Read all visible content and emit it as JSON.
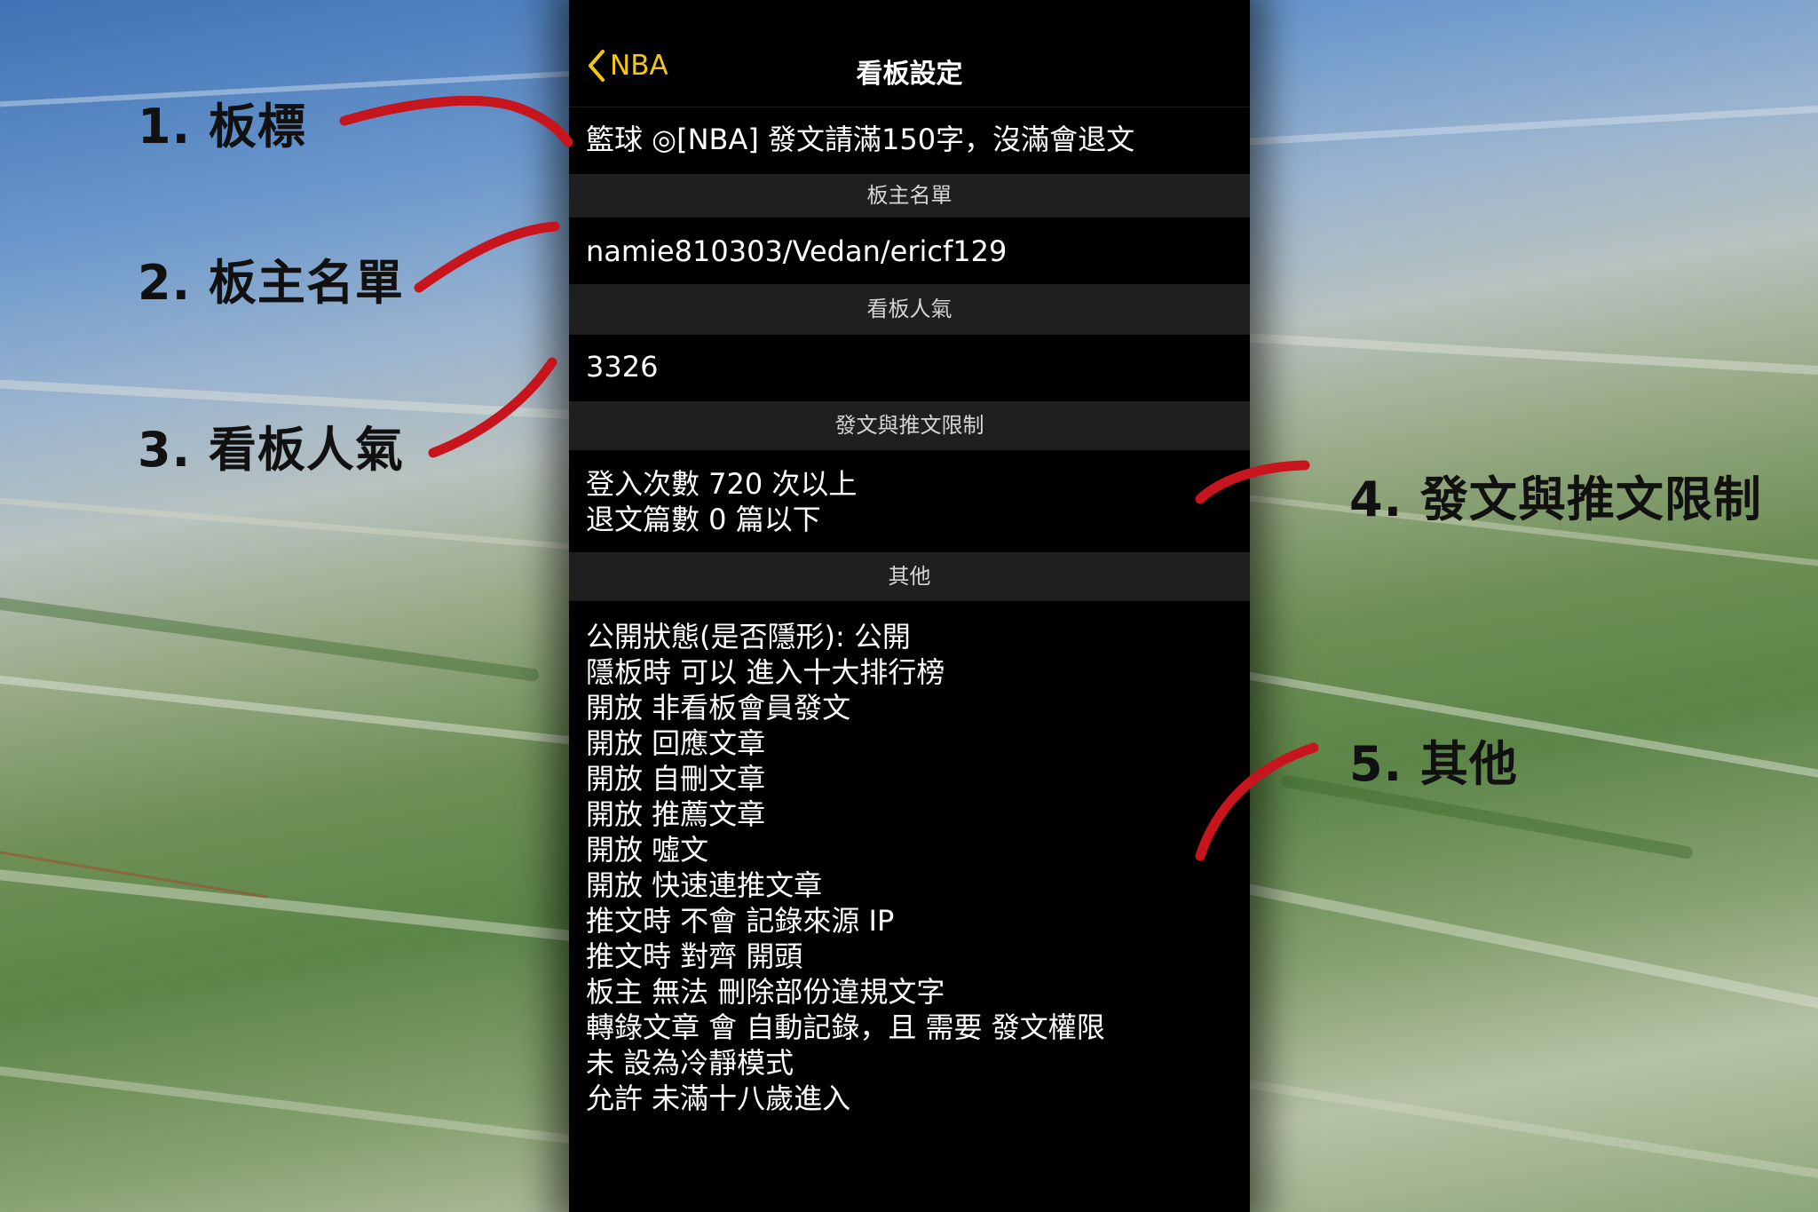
{
  "nav": {
    "back_label": "NBA",
    "title": "看板設定"
  },
  "board_title": "籃球 ◎[NBA] 發文請滿150字，沒滿會退文",
  "sections": {
    "moderators": {
      "header": "板主名單",
      "value": "namie810303/Vedan/ericf129"
    },
    "popularity": {
      "header": "看板人氣",
      "value": "3326"
    },
    "restrictions": {
      "header": "發文與推文限制",
      "lines": [
        "登入次數 720 次以上",
        "退文篇數 0 篇以下"
      ]
    },
    "other": {
      "header": "其他",
      "lines": [
        "公開狀態(是否隱形): 公開",
        "隱板時 可以 進入十大排行榜",
        "開放 非看板會員發文",
        "開放 回應文章",
        "開放 自刪文章",
        "開放 推薦文章",
        "開放 噓文",
        "開放 快速連推文章",
        "推文時 不會 記錄來源 IP",
        "推文時 對齊 開頭",
        "板主 無法 刪除部份違規文字",
        "轉錄文章 會 自動記錄，且 需要 發文權限",
        "未 設為冷靜模式",
        "允許 未滿十八歲進入"
      ]
    }
  },
  "annotations": [
    "1. 板標",
    "2. 板主名單",
    "3. 看板人氣",
    "4. 發文與推文限制",
    "5. 其他"
  ],
  "colors": {
    "accent": "#f5c518",
    "panel": "#000000",
    "section_header_bg": "#1f1f1f",
    "annotation_stroke": "#c8141c"
  }
}
